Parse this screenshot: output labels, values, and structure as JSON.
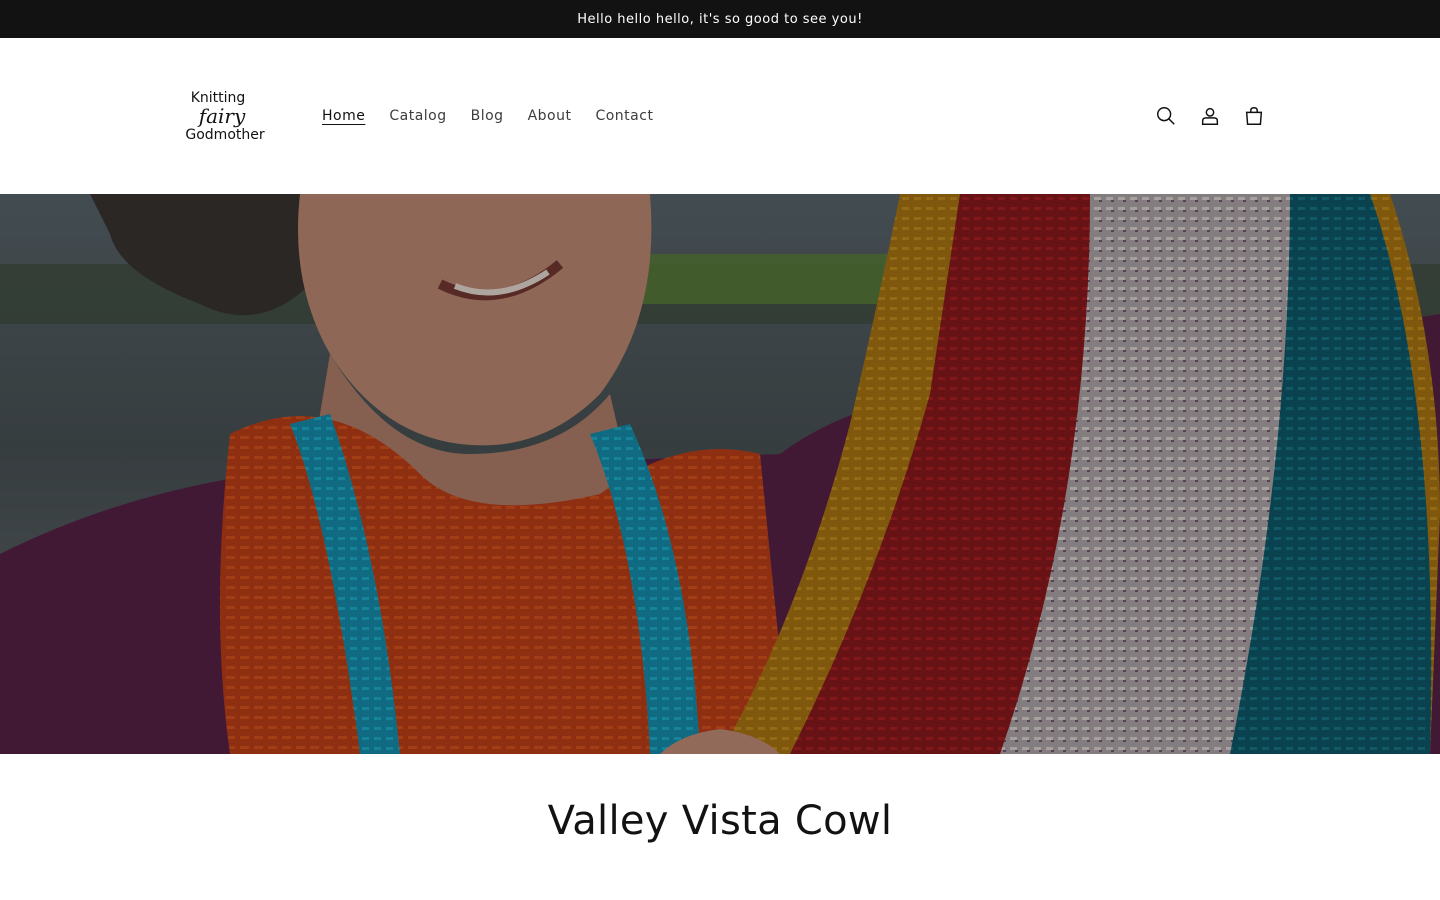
{
  "announcement": {
    "text": "Hello hello hello, it's so good to see you!"
  },
  "header": {
    "logo": {
      "line1": "Knitting",
      "line2": "fairy",
      "line3": "Godmother"
    },
    "nav": [
      {
        "label": "Home",
        "active": true
      },
      {
        "label": "Catalog",
        "active": false
      },
      {
        "label": "Blog",
        "active": false
      },
      {
        "label": "About",
        "active": false
      },
      {
        "label": "Contact",
        "active": false
      }
    ],
    "icons": [
      "search-icon",
      "account-icon",
      "cart-icon"
    ]
  },
  "hero": {
    "image": "woman holding crocheted cowls",
    "overlay": true
  },
  "product": {
    "title": "Valley Vista Cowl"
  },
  "colors": {
    "announcement_bg": "#121212",
    "text": "#121212",
    "nav": "#3d3d3d",
    "background": "#ffffff"
  }
}
